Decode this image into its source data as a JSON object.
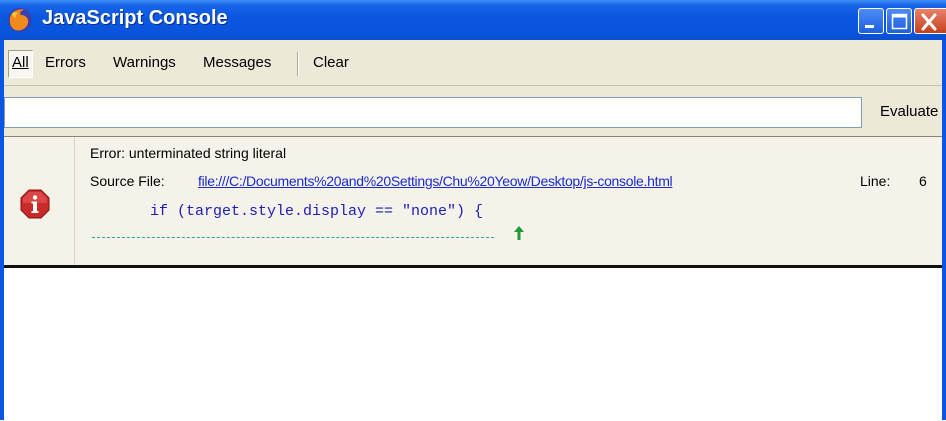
{
  "window": {
    "title": "JavaScript Console",
    "app_icon": "firefox-icon",
    "controls": [
      "minimize-icon",
      "maximize-icon",
      "close-icon"
    ],
    "colors": {
      "titlebar": "#0a55e3",
      "close_button": "#d9542f",
      "client_bg": "#ece9d8"
    }
  },
  "toolbar": {
    "filters": [
      {
        "label": "All",
        "active": true
      },
      {
        "label": "Errors",
        "active": false
      },
      {
        "label": "Warnings",
        "active": false
      },
      {
        "label": "Messages",
        "active": false
      }
    ],
    "clear_label": "Clear"
  },
  "evaluate": {
    "input_value": "",
    "button_label": "Evaluate"
  },
  "entries": [
    {
      "type": "error",
      "icon": "error-icon",
      "message": "Error:  unterminated string literal",
      "source_label": "Source File:",
      "source_file": "file:///C:/Documents%20and%20Settings/Chu%20Yeow/Desktop/js-console.html",
      "line_label": "Line:",
      "line_number": "6",
      "source_code": "if (target.style.display == \"none\") {",
      "caret_icon": "up-arrow-icon"
    }
  ]
}
